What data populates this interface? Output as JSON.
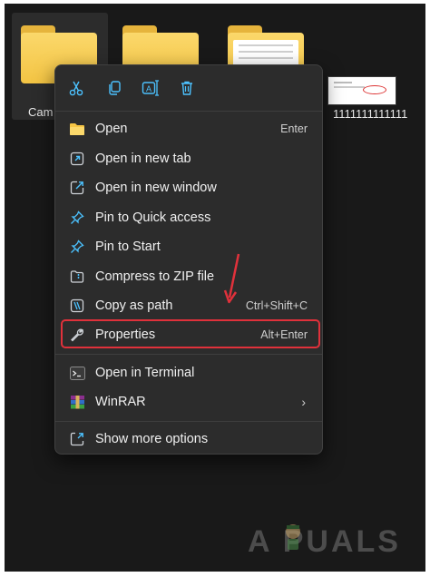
{
  "desktop": {
    "tiles": [
      {
        "label": "Cam"
      },
      {
        "label": ""
      },
      {
        "label": ""
      },
      {
        "label": "1111111111111"
      }
    ]
  },
  "quick_actions": [
    {
      "name": "cut-icon"
    },
    {
      "name": "copy-icon"
    },
    {
      "name": "rename-icon"
    },
    {
      "name": "delete-icon"
    }
  ],
  "menu": {
    "items": [
      {
        "label": "Open",
        "shortcut": "Enter",
        "icon": "folder-icon"
      },
      {
        "label": "Open in new tab",
        "shortcut": "",
        "icon": "new-tab-icon"
      },
      {
        "label": "Open in new window",
        "shortcut": "",
        "icon": "new-window-icon"
      },
      {
        "label": "Pin to Quick access",
        "shortcut": "",
        "icon": "pin-icon"
      },
      {
        "label": "Pin to Start",
        "shortcut": "",
        "icon": "pin-icon"
      },
      {
        "label": "Compress to ZIP file",
        "shortcut": "",
        "icon": "zip-icon"
      },
      {
        "label": "Copy as path",
        "shortcut": "Ctrl+Shift+C",
        "icon": "copy-path-icon"
      },
      {
        "label": "Properties",
        "shortcut": "Alt+Enter",
        "icon": "wrench-icon",
        "highlighted": true
      },
      {
        "label": "Open in Terminal",
        "shortcut": "",
        "icon": "terminal-icon"
      },
      {
        "label": "WinRAR",
        "shortcut": "",
        "icon": "winrar-icon",
        "submenu": true
      },
      {
        "label": "Show more options",
        "shortcut": "",
        "icon": "more-options-icon"
      }
    ]
  },
  "watermark": {
    "text": "A  PUALS"
  },
  "colors": {
    "accent": "#4cc2ff",
    "highlight_border": "#e0313b",
    "menu_bg": "#2c2c2c"
  }
}
